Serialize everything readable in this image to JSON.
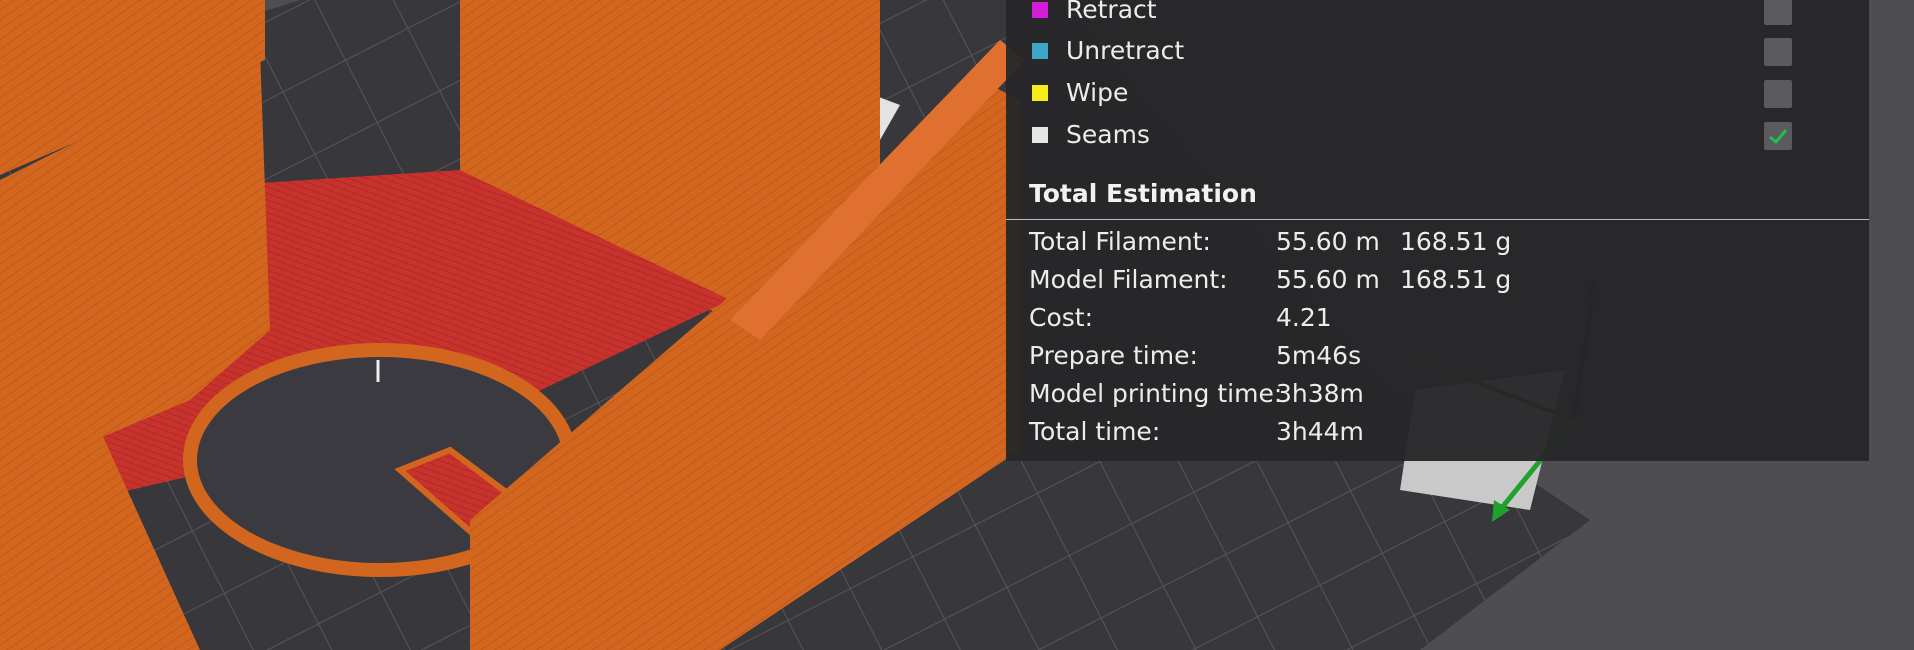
{
  "legend": {
    "items": [
      {
        "label": "Retract",
        "color": "#d21fd7",
        "checked": false
      },
      {
        "label": "Unretract",
        "color": "#3ba7c9",
        "checked": false
      },
      {
        "label": "Wipe",
        "color": "#f5ee1b",
        "checked": false
      },
      {
        "label": "Seams",
        "color": "#e6e6e6",
        "checked": true
      }
    ]
  },
  "estimation": {
    "title": "Total Estimation",
    "rows": [
      {
        "label": "Total Filament:",
        "value": "55.60 m",
        "value2": "168.51 g"
      },
      {
        "label": "Model Filament:",
        "value": "55.60 m",
        "value2": "168.51 g"
      },
      {
        "label": "Cost:",
        "value": "4.21",
        "value2": ""
      },
      {
        "label": "Prepare time:",
        "value": "5m46s",
        "value2": ""
      },
      {
        "label": "Model printing time:",
        "value": "3h38m",
        "value2": ""
      },
      {
        "label": "Total time:",
        "value": "3h44m",
        "value2": ""
      }
    ]
  },
  "colors": {
    "model": "#d3661f",
    "infill": "#c8322d",
    "bed": "#38383c",
    "panel": "#262628",
    "check": "#1fbf4f"
  }
}
